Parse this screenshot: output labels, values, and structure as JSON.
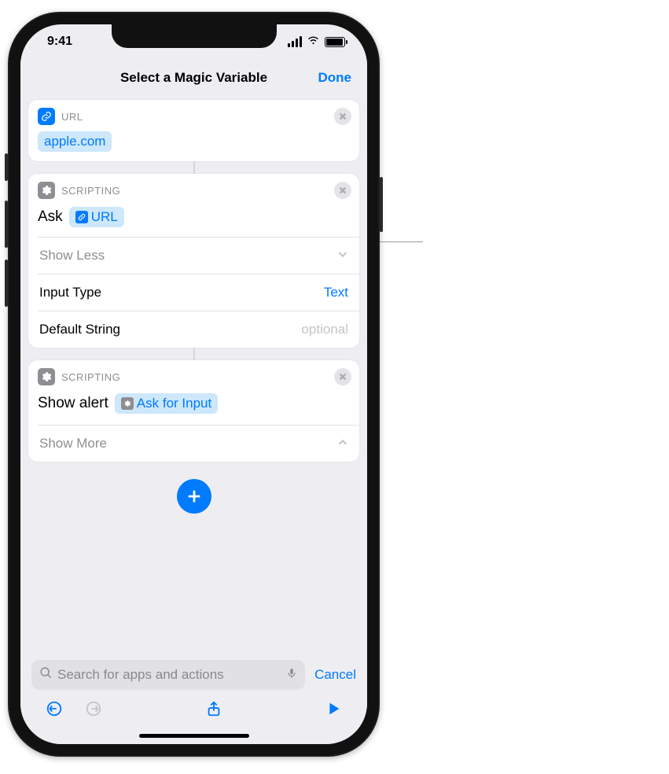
{
  "status": {
    "time": "9:41"
  },
  "nav": {
    "title": "Select a Magic Variable",
    "done": "Done"
  },
  "card_url": {
    "category": "URL",
    "token": "apple.com"
  },
  "card_ask": {
    "category": "SCRIPTING",
    "action_label": "Ask",
    "variable_token": "URL",
    "show_less": "Show Less",
    "rows": {
      "input_type_label": "Input Type",
      "input_type_value": "Text",
      "default_string_label": "Default String",
      "default_string_placeholder": "optional"
    }
  },
  "card_alert": {
    "category": "SCRIPTING",
    "action_label": "Show alert",
    "variable_token": "Ask for Input",
    "show_more": "Show More"
  },
  "search": {
    "placeholder": "Search for apps and actions",
    "cancel": "Cancel"
  }
}
